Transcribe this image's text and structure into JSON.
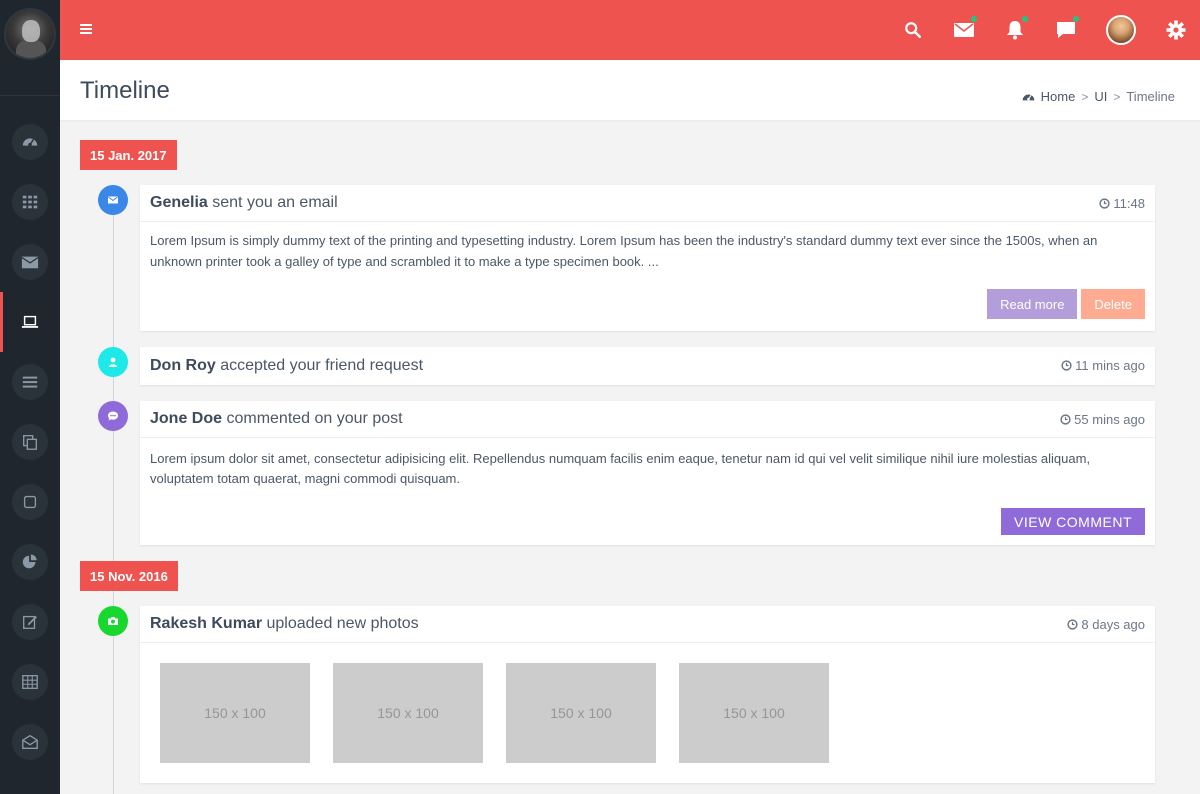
{
  "topbar": {
    "menu_icon": "hamburger-icon",
    "icons": [
      "search-icon",
      "mail-icon",
      "bell-icon",
      "chat-icon",
      "user-avatar",
      "gear-icon"
    ],
    "accent": "#ef5350",
    "notification_dot": "#26c281"
  },
  "sidebar": {
    "items": [
      {
        "icon": "dashboard-icon"
      },
      {
        "icon": "apps-grid-icon"
      },
      {
        "icon": "mail-icon"
      },
      {
        "icon": "laptop-icon",
        "active": true
      },
      {
        "icon": "list-icon"
      },
      {
        "icon": "copy-icon"
      },
      {
        "icon": "square-icon"
      },
      {
        "icon": "pie-chart-icon"
      },
      {
        "icon": "edit-icon"
      },
      {
        "icon": "table-icon"
      },
      {
        "icon": "envelope-open-icon"
      }
    ]
  },
  "page": {
    "title": "Timeline",
    "breadcrumb": {
      "home": "Home",
      "ui": "UI",
      "current": "Timeline"
    }
  },
  "timeline": {
    "dates": [
      "15 Jan. 2017",
      "15 Nov. 2016"
    ],
    "entries": [
      {
        "name": "Genelia",
        "action": " sent you an email",
        "time": "11:48",
        "icon": "envelope-icon",
        "color": "#3a87e8",
        "body": "Lorem Ipsum is simply dummy text of the printing and typesetting industry. Lorem Ipsum has been the industry's standard dummy text ever since the 1500s, when an unknown printer took a galley of type and scrambled it to make a type specimen book. ...",
        "buttons": [
          "Read more",
          "Delete"
        ]
      },
      {
        "name": "Don Roy",
        "action": " accepted your friend request",
        "time": "11 mins ago",
        "icon": "user-icon",
        "color": "#1de9e9"
      },
      {
        "name": "Jone Doe",
        "action": " commented on your post",
        "time": "55 mins ago",
        "icon": "comment-icon",
        "color": "#8e6bd8",
        "body": "Lorem ipsum dolor sit amet, consectetur adipisicing elit. Repellendus numquam facilis enim eaque, tenetur nam id qui vel velit similique nihil iure molestias aliquam, voluptatem totam quaerat, magni commodi quisquam.",
        "buttons": [
          "VIEW COMMENT"
        ]
      },
      {
        "name": "Rakesh Kumar",
        "action": " uploaded new photos",
        "time": "8 days ago",
        "icon": "camera-icon",
        "color": "#18d830",
        "photos": [
          "150 x 100",
          "150 x 100",
          "150 x 100",
          "150 x 100"
        ]
      }
    ]
  }
}
